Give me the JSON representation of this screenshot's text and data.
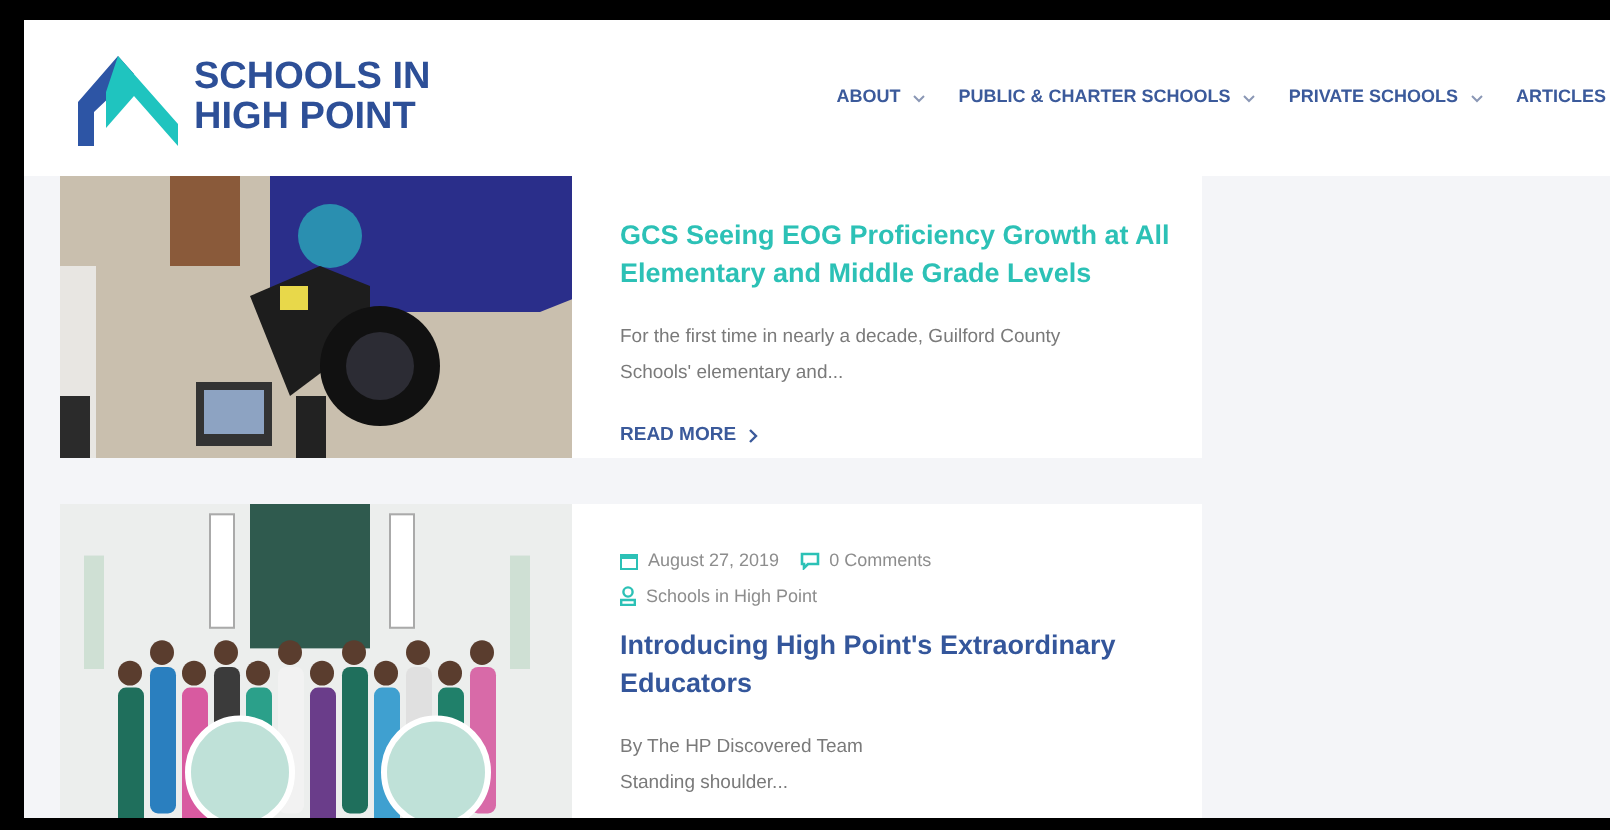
{
  "header": {
    "logo_text": [
      "SCHOOLS IN",
      "HIGH POINT"
    ],
    "nav": [
      {
        "label": "ABOUT",
        "dropdown": true
      },
      {
        "label": "PUBLIC & CHARTER SCHOOLS",
        "dropdown": true
      },
      {
        "label": "PRIVATE SCHOOLS",
        "dropdown": true
      },
      {
        "label": "ARTICLES",
        "dropdown": false
      }
    ]
  },
  "posts": [
    {
      "title": "GCS Seeing EOG Proficiency Growth at All Elementary and Middle Grade Levels",
      "hovered": true,
      "excerpt": [
        "For the first time in nearly a decade, Guilford County",
        "Schools' elementary and..."
      ],
      "read_more": "READ MORE"
    },
    {
      "date": "August 27, 2019",
      "comments": "0 Comments",
      "author": "Schools in High Point",
      "title": "Introducing High Point's Extraordinary Educators",
      "hovered": false,
      "excerpt": [
        "By The HP Discovered Team",
        "Standing shoulder..."
      ]
    }
  ]
}
